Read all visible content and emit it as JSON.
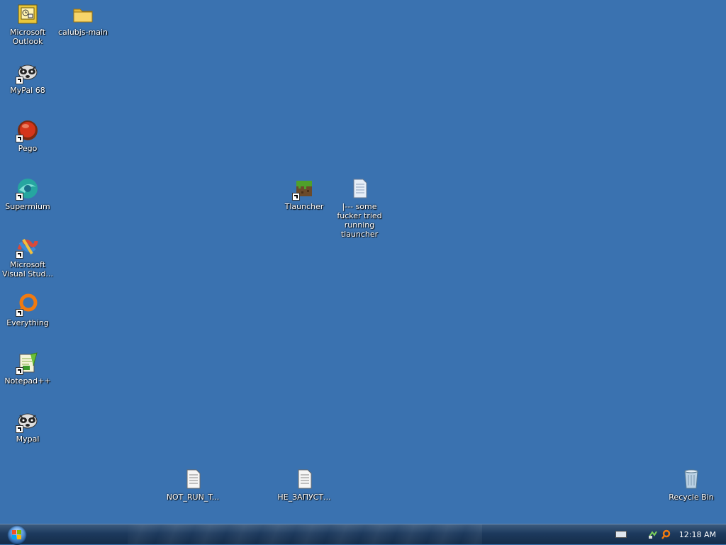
{
  "desktop": {
    "icons": {
      "outlook": "Microsoft Outlook",
      "calubjs": "calubjs-main",
      "mypal68": "MyPal 68",
      "pego": "Pego",
      "supermium": "Supermium",
      "vs": "Microsoft Visual Stud...",
      "everything": "Everything",
      "notepadpp": "Notepad++",
      "mypal": "Mypal",
      "tlauncher": "Tlauncher",
      "note_file": "|--- some fucker tried running tlauncher",
      "not_run": "NOT_RUN_T...",
      "ne_zapusk": "НЕ_ЗАПУСТ...",
      "recycle": "Recycle Bin"
    }
  },
  "taskbar": {
    "clock": "12:18 AM"
  },
  "colors": {
    "desktop_bg": "#3a72b0",
    "taskbar_dark": "#142c49"
  }
}
